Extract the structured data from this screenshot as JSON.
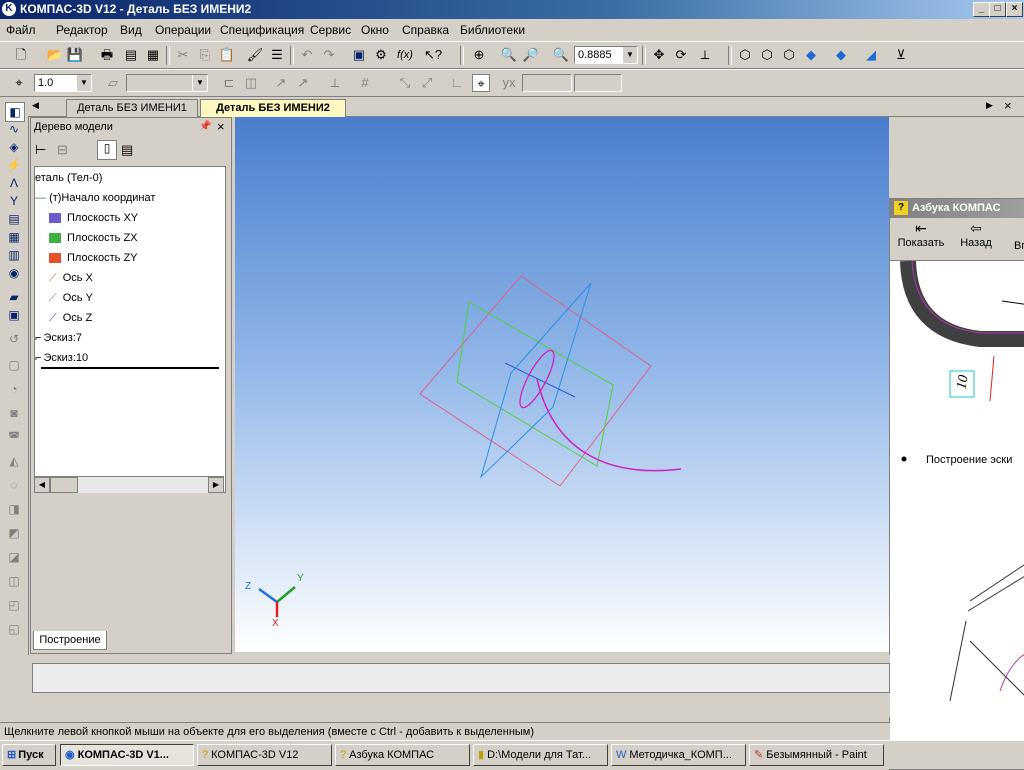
{
  "window": {
    "title": "КОМПАС-3D V12 - Деталь БЕЗ ИМЕНИ2"
  },
  "menu": [
    "Файл",
    "Редактор",
    "Вид",
    "Операции",
    "Спецификация",
    "Сервис",
    "Окно",
    "Справка",
    "Библиотеки"
  ],
  "toolbar": {
    "zoom_value": "0.8885",
    "line_scale": "1.0"
  },
  "tabs": [
    {
      "label": "Деталь БЕЗ ИМЕНИ1"
    },
    {
      "label": "Деталь БЕЗ ИМЕНИ2"
    }
  ],
  "tree": {
    "panel_title": "Дерево модели",
    "items": [
      {
        "label": "еталь (Тел-0)"
      },
      {
        "label": "(т)Начало координат"
      },
      {
        "label": "Плоскость XY"
      },
      {
        "label": "Плоскость ZX"
      },
      {
        "label": "Плоскость ZY"
      },
      {
        "label": "Ось X"
      },
      {
        "label": "Ось Y"
      },
      {
        "label": "Ось Z"
      },
      {
        "label": "Эскиз:7"
      },
      {
        "label": "Эскиз:10"
      }
    ],
    "bottom_tab": "Построение",
    "colors": {
      "xy": "#6a5acd",
      "zx": "#3cb043",
      "zy": "#e8502a"
    }
  },
  "axes_labels": {
    "x": "X",
    "y": "Y",
    "z": "Z"
  },
  "help": {
    "title": "Азбука КОМПАС",
    "buttons": [
      "Показать",
      "Назад",
      "Вп"
    ],
    "dimension_label": "10",
    "bullet_text": "Построение эски"
  },
  "status": {
    "text": "Щелкните левой кнопкой мыши на объекте для его выделения (вместе с Ctrl - добавить к выделенным)"
  },
  "taskbar": {
    "start_label": "Пуск",
    "items": [
      {
        "label": "КОМПАС-3D V1..."
      },
      {
        "label": "КОМПАС-3D V12"
      },
      {
        "label": "Азбука КОМПАС"
      },
      {
        "label": "D:\\Модели для Тат..."
      },
      {
        "label": "Методичка_КОМП..."
      },
      {
        "label": "Безымянный - Paint"
      }
    ]
  }
}
